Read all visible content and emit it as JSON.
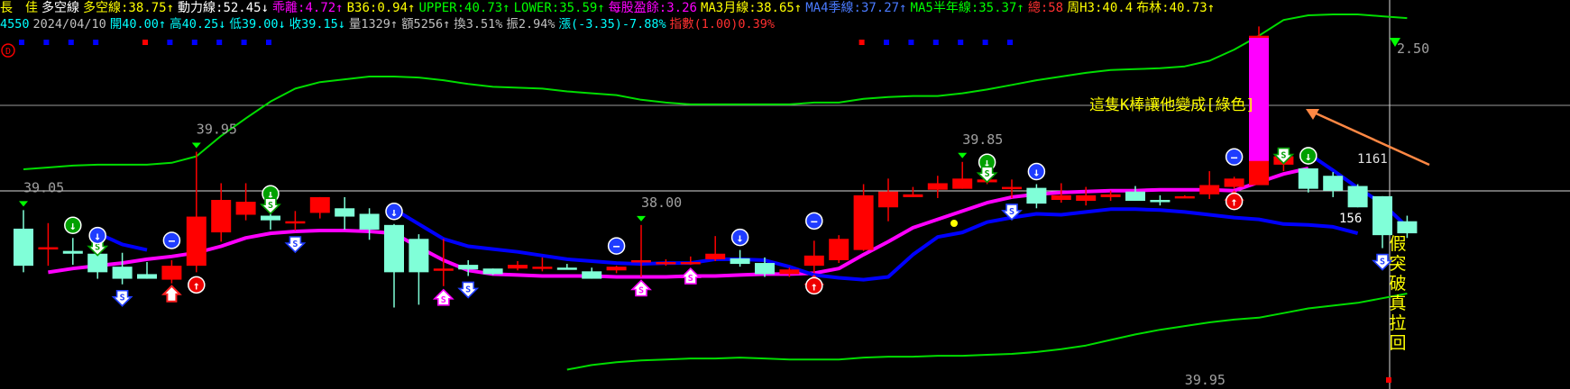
{
  "header": {
    "row1": [
      {
        "text": "長　佳",
        "color": "#ffff00"
      },
      {
        "text": "多空線",
        "color": "#ffffff"
      },
      {
        "text": "多空線:38.75↑",
        "color": "#ffff00"
      },
      {
        "text": "動力線:52.45↓",
        "color": "#ffffff"
      },
      {
        "text": "乖離:4.72↑",
        "color": "#ff00ff"
      },
      {
        "text": "B36:0.94↑",
        "color": "#ffff00"
      },
      {
        "text": "UPPER:40.73↑",
        "color": "#00ff00"
      },
      {
        "text": "LOWER:35.59↑",
        "color": "#00ff00"
      },
      {
        "text": "每股盈餘:3.26",
        "color": "#ff00ff"
      },
      {
        "text": "MA3月線:38.65↑",
        "color": "#ffff00"
      },
      {
        "text": "MA4季線:37.27↑",
        "color": "#4a7bff"
      },
      {
        "text": "MA5半年線:35.37↑",
        "color": "#00ff00"
      },
      {
        "text": "總:58",
        "color": "#ff3030"
      },
      {
        "text": "周H3:40.4",
        "color": "#ffff00"
      },
      {
        "text": "布林:40.73↑",
        "color": "#ffff00"
      }
    ],
    "row2": [
      {
        "text": "4550",
        "color": "#00ffff"
      },
      {
        "text": "2024/04/10",
        "color": "#c0c0c0"
      },
      {
        "text": "開40.00↑",
        "color": "#00ffff"
      },
      {
        "text": "高40.25↓",
        "color": "#00ffff"
      },
      {
        "text": "低39.00↓",
        "color": "#00ffff"
      },
      {
        "text": "收39.15↓",
        "color": "#00ffff"
      },
      {
        "text": "量1329↑",
        "color": "#c0c0c0"
      },
      {
        "text": "額5256↑",
        "color": "#c0c0c0"
      },
      {
        "text": "換3.51%",
        "color": "#c0c0c0"
      },
      {
        "text": "振2.94%",
        "color": "#c0c0c0"
      },
      {
        "text": "漲(-3.35)-7.88%",
        "color": "#00ffff"
      },
      {
        "text": "指數(1.00)0.39%",
        "color": "#ff3030"
      }
    ]
  },
  "annotations": {
    "callout": "這隻K棒讓他變成[綠色]",
    "vertical_note": "假突破真拉回",
    "d_badge": "D",
    "cursor_price": "42.50",
    "cursor_price_visible": "2.50",
    "cursor_count": "1161",
    "small_num": "156"
  },
  "colors": {
    "up_candle": "#ff0000",
    "down_candle": "#80ffd8",
    "ma_month": "#ff00ff",
    "ma_quarter": "#0000ff",
    "bollinger": "#00dd00",
    "highlight_bar": "#ff00ff",
    "callout_text": "#ffff00",
    "arrow": "#ff8844"
  },
  "chart_data": {
    "type": "candlestick",
    "y_range_approx": [
      39.5,
      42.7
    ],
    "price_labels": [
      {
        "text": "39.05",
        "i": 0
      },
      {
        "text": "39.95",
        "i": 7
      },
      {
        "text": "38.00",
        "i": 25
      },
      {
        "text": "39.85",
        "i": 38
      },
      {
        "text": "39.95",
        "i": 47
      }
    ],
    "candles": [
      {
        "o": 40.52,
        "h": 40.72,
        "l": 40.05,
        "c": 40.12
      },
      {
        "o": 40.32,
        "h": 40.58,
        "l": 40.12,
        "c": 40.32
      },
      {
        "o": 40.28,
        "h": 40.42,
        "l": 40.13,
        "c": 40.25
      },
      {
        "o": 40.25,
        "h": 40.31,
        "l": 39.98,
        "c": 40.05
      },
      {
        "o": 40.11,
        "h": 40.26,
        "l": 39.92,
        "c": 39.98
      },
      {
        "o": 40.03,
        "h": 40.16,
        "l": 39.98,
        "c": 39.98
      },
      {
        "o": 39.97,
        "h": 40.18,
        "l": 39.93,
        "c": 40.12
      },
      {
        "o": 40.12,
        "h": 41.35,
        "l": 40.05,
        "c": 40.65
      },
      {
        "o": 40.48,
        "h": 41.01,
        "l": 40.38,
        "c": 40.83
      },
      {
        "o": 40.67,
        "h": 41.01,
        "l": 40.61,
        "c": 40.81
      },
      {
        "o": 40.66,
        "h": 40.76,
        "l": 40.51,
        "c": 40.61
      },
      {
        "o": 40.6,
        "h": 40.71,
        "l": 40.5,
        "c": 40.6
      },
      {
        "o": 40.69,
        "h": 40.86,
        "l": 40.63,
        "c": 40.86
      },
      {
        "o": 40.74,
        "h": 40.86,
        "l": 40.51,
        "c": 40.65
      },
      {
        "o": 40.68,
        "h": 40.74,
        "l": 40.4,
        "c": 40.51
      },
      {
        "o": 40.56,
        "h": 40.57,
        "l": 39.67,
        "c": 40.05
      },
      {
        "o": 40.41,
        "h": 40.46,
        "l": 39.7,
        "c": 40.05
      },
      {
        "o": 40.09,
        "h": 40.41,
        "l": 39.9,
        "c": 40.09
      },
      {
        "o": 40.13,
        "h": 40.18,
        "l": 40.01,
        "c": 40.08
      },
      {
        "o": 40.09,
        "h": 40.09,
        "l": 40.02,
        "c": 40.03
      },
      {
        "o": 40.09,
        "h": 40.17,
        "l": 40.07,
        "c": 40.13
      },
      {
        "o": 40.11,
        "h": 40.21,
        "l": 40.06,
        "c": 40.11
      },
      {
        "o": 40.1,
        "h": 40.14,
        "l": 40.08,
        "c": 40.08
      },
      {
        "o": 40.06,
        "h": 40.1,
        "l": 39.98,
        "c": 39.98
      },
      {
        "o": 40.07,
        "h": 40.12,
        "l": 40.04,
        "c": 40.11
      },
      {
        "o": 40.16,
        "h": 40.56,
        "l": 40.0,
        "c": 40.18
      },
      {
        "o": 40.16,
        "h": 40.19,
        "l": 40.12,
        "c": 40.16
      },
      {
        "o": 40.14,
        "h": 40.22,
        "l": 40.13,
        "c": 40.16
      },
      {
        "o": 40.19,
        "h": 40.44,
        "l": 40.17,
        "c": 40.25
      },
      {
        "o": 40.2,
        "h": 40.29,
        "l": 40.11,
        "c": 40.14
      },
      {
        "o": 40.15,
        "h": 40.21,
        "l": 40.0,
        "c": 40.03
      },
      {
        "o": 40.03,
        "h": 40.1,
        "l": 40.0,
        "c": 40.08
      },
      {
        "o": 40.12,
        "h": 40.39,
        "l": 40.04,
        "c": 40.23
      },
      {
        "o": 40.18,
        "h": 40.45,
        "l": 40.15,
        "c": 40.41
      },
      {
        "o": 40.29,
        "h": 41.0,
        "l": 40.28,
        "c": 40.88
      },
      {
        "o": 40.75,
        "h": 41.06,
        "l": 40.6,
        "c": 40.92
      },
      {
        "o": 40.86,
        "h": 40.97,
        "l": 40.86,
        "c": 40.89
      },
      {
        "o": 40.94,
        "h": 41.09,
        "l": 40.85,
        "c": 41.01
      },
      {
        "o": 40.95,
        "h": 41.24,
        "l": 40.95,
        "c": 41.06
      },
      {
        "o": 41.02,
        "h": 41.1,
        "l": 41.0,
        "c": 41.05
      },
      {
        "o": 40.97,
        "h": 41.05,
        "l": 40.85,
        "c": 40.97
      },
      {
        "o": 40.96,
        "h": 41.0,
        "l": 40.74,
        "c": 40.79
      },
      {
        "o": 40.83,
        "h": 41.01,
        "l": 40.8,
        "c": 40.88
      },
      {
        "o": 40.82,
        "h": 40.97,
        "l": 40.77,
        "c": 40.88
      },
      {
        "o": 40.86,
        "h": 40.93,
        "l": 40.82,
        "c": 40.89
      },
      {
        "o": 40.92,
        "h": 40.98,
        "l": 40.82,
        "c": 40.82
      },
      {
        "o": 40.83,
        "h": 40.88,
        "l": 40.77,
        "c": 40.82
      },
      {
        "o": 40.86,
        "h": 40.88,
        "l": 40.85,
        "c": 40.87
      },
      {
        "o": 40.89,
        "h": 41.14,
        "l": 40.84,
        "c": 40.99
      },
      {
        "o": 40.97,
        "h": 41.08,
        "l": 40.95,
        "c": 41.06
      },
      {
        "o": 40.99,
        "h": 42.7,
        "l": 40.99,
        "c": 42.6
      },
      {
        "o": 41.21,
        "h": 41.3,
        "l": 41.14,
        "c": 41.3
      },
      {
        "o": 41.17,
        "h": 41.17,
        "l": 40.91,
        "c": 40.95
      },
      {
        "o": 41.09,
        "h": 41.13,
        "l": 40.86,
        "c": 40.93
      },
      {
        "o": 40.98,
        "h": 41.0,
        "l": 40.75,
        "c": 40.75
      },
      {
        "o": 40.87,
        "h": 40.87,
        "l": 40.31,
        "c": 40.45
      },
      {
        "o": 40.6,
        "h": 40.66,
        "l": 40.42,
        "c": 40.47
      }
    ],
    "ma_month": [
      null,
      40.05,
      40.09,
      40.12,
      40.15,
      40.19,
      40.22,
      40.26,
      40.33,
      40.42,
      40.47,
      40.49,
      40.5,
      40.5,
      40.49,
      40.47,
      40.32,
      40.18,
      40.07,
      40.03,
      40.02,
      40.01,
      40.01,
      40.01,
      40.0,
      40.0,
      40.0,
      40.01,
      40.01,
      40.02,
      40.03,
      40.03,
      40.04,
      40.09,
      40.24,
      40.38,
      40.53,
      40.62,
      40.71,
      40.8,
      40.86,
      40.89,
      40.91,
      40.92,
      40.93,
      40.93,
      40.94,
      40.94,
      40.94,
      40.93,
      41.02,
      41.11,
      41.17
    ],
    "ma_quarter_segments": [
      {
        "from": 3,
        "values": [
          40.47,
          40.35,
          40.29
        ]
      },
      {
        "from": 15,
        "values": [
          40.73,
          40.57,
          40.41,
          40.33,
          40.3,
          40.27,
          40.23,
          40.19,
          40.17,
          40.15,
          40.14,
          40.15,
          40.15,
          40.19,
          40.19,
          40.18,
          40.11,
          40.02,
          39.99,
          39.97,
          40.0,
          40.24,
          40.43,
          40.48,
          40.59,
          40.64,
          40.68,
          40.67,
          40.7,
          40.73,
          40.73,
          40.72,
          40.7,
          40.67,
          40.64,
          40.62,
          40.57,
          40.56,
          40.54,
          40.47
        ]
      },
      {
        "from": 52,
        "values": [
          41.33,
          41.15,
          40.96,
          40.79,
          40.54
        ]
      }
    ],
    "boll_upper": [
      41.16,
      41.18,
      41.2,
      41.21,
      41.21,
      41.21,
      41.23,
      41.3,
      41.52,
      41.71,
      41.89,
      42.03,
      42.1,
      42.13,
      42.16,
      42.16,
      42.15,
      42.12,
      42.08,
      42.05,
      42.04,
      42.03,
      42.0,
      41.98,
      41.96,
      41.91,
      41.88,
      41.86,
      41.86,
      41.86,
      41.86,
      41.86,
      41.88,
      41.88,
      41.92,
      41.94,
      41.95,
      41.95,
      41.98,
      42.02,
      42.07,
      42.12,
      42.16,
      42.2,
      42.23,
      42.24,
      42.25,
      42.27,
      42.33,
      42.45,
      42.6,
      42.77,
      42.82,
      42.83,
      42.83,
      42.81,
      42.79
    ],
    "boll_lower": [
      null,
      null,
      null,
      null,
      null,
      null,
      null,
      null,
      null,
      null,
      null,
      null,
      null,
      null,
      null,
      null,
      null,
      null,
      null,
      null,
      null,
      null,
      39.0,
      39.05,
      39.08,
      39.1,
      39.11,
      39.12,
      39.12,
      39.13,
      39.12,
      39.11,
      39.11,
      39.11,
      39.13,
      39.14,
      39.14,
      39.15,
      39.15,
      39.16,
      39.17,
      39.19,
      39.22,
      39.26,
      39.32,
      39.38,
      39.43,
      39.47,
      39.51,
      39.54,
      39.56,
      39.61,
      39.66,
      39.69,
      39.72,
      39.77,
      39.82
    ],
    "signals": [
      {
        "i": 2,
        "kind": "green-down-circle"
      },
      {
        "i": 3,
        "kind": "green-S-down"
      },
      {
        "i": 3,
        "kind": "blue-down-circle"
      },
      {
        "i": 4,
        "kind": "blue-S-down"
      },
      {
        "i": 6,
        "kind": "blue-minus-circle"
      },
      {
        "i": 6,
        "kind": "red-up-arrow"
      },
      {
        "i": 7,
        "kind": "red-up-circle"
      },
      {
        "i": 10,
        "kind": "green-down-circle"
      },
      {
        "i": 10,
        "kind": "green-S-down"
      },
      {
        "i": 11,
        "kind": "blue-S-down"
      },
      {
        "i": 15,
        "kind": "blue-down-circle"
      },
      {
        "i": 17,
        "kind": "pink-S-up"
      },
      {
        "i": 18,
        "kind": "blue-S-down"
      },
      {
        "i": 24,
        "kind": "blue-minus-circle"
      },
      {
        "i": 25,
        "kind": "pink-S-up"
      },
      {
        "i": 27,
        "kind": "pink-S-up"
      },
      {
        "i": 29,
        "kind": "blue-down-circle"
      },
      {
        "i": 32,
        "kind": "blue-minus-circle"
      },
      {
        "i": 32,
        "kind": "red-up-arrow"
      },
      {
        "i": 32,
        "kind": "red-up-circle"
      },
      {
        "i": 39,
        "kind": "green-down-circle"
      },
      {
        "i": 39,
        "kind": "green-S-down"
      },
      {
        "i": 40,
        "kind": "blue-S-down"
      },
      {
        "i": 41,
        "kind": "blue-down-circle"
      },
      {
        "i": 49,
        "kind": "blue-minus-circle"
      },
      {
        "i": 49,
        "kind": "red-up-arrow"
      },
      {
        "i": 49,
        "kind": "red-up-circle"
      },
      {
        "i": 51,
        "kind": "green-S-down"
      },
      {
        "i": 52,
        "kind": "blue-down-circle"
      },
      {
        "i": 52,
        "kind": "green-down-circle"
      },
      {
        "i": 55,
        "kind": "blue-S-down"
      }
    ],
    "top_markers": [
      {
        "i": 0,
        "color": "#0000ff"
      },
      {
        "i": 1,
        "color": "#0000ff"
      },
      {
        "i": 2,
        "color": "#0000ff"
      },
      {
        "i": 3,
        "color": "#0000ff"
      },
      {
        "i": 5,
        "color": "#ff0000"
      },
      {
        "i": 6,
        "color": "#0000ff"
      },
      {
        "i": 7,
        "color": "#0000ff"
      },
      {
        "i": 8,
        "color": "#0000ff"
      },
      {
        "i": 9,
        "color": "#0000ff"
      },
      {
        "i": 10,
        "color": "#0000ff"
      },
      {
        "i": 34,
        "color": "#ff0000"
      },
      {
        "i": 35,
        "color": "#0000ff"
      },
      {
        "i": 36,
        "color": "#0000ff"
      },
      {
        "i": 37,
        "color": "#0000ff"
      },
      {
        "i": 38,
        "color": "#0000ff"
      },
      {
        "i": 39,
        "color": "#0000ff"
      },
      {
        "i": 40,
        "color": "#0000ff"
      }
    ]
  }
}
